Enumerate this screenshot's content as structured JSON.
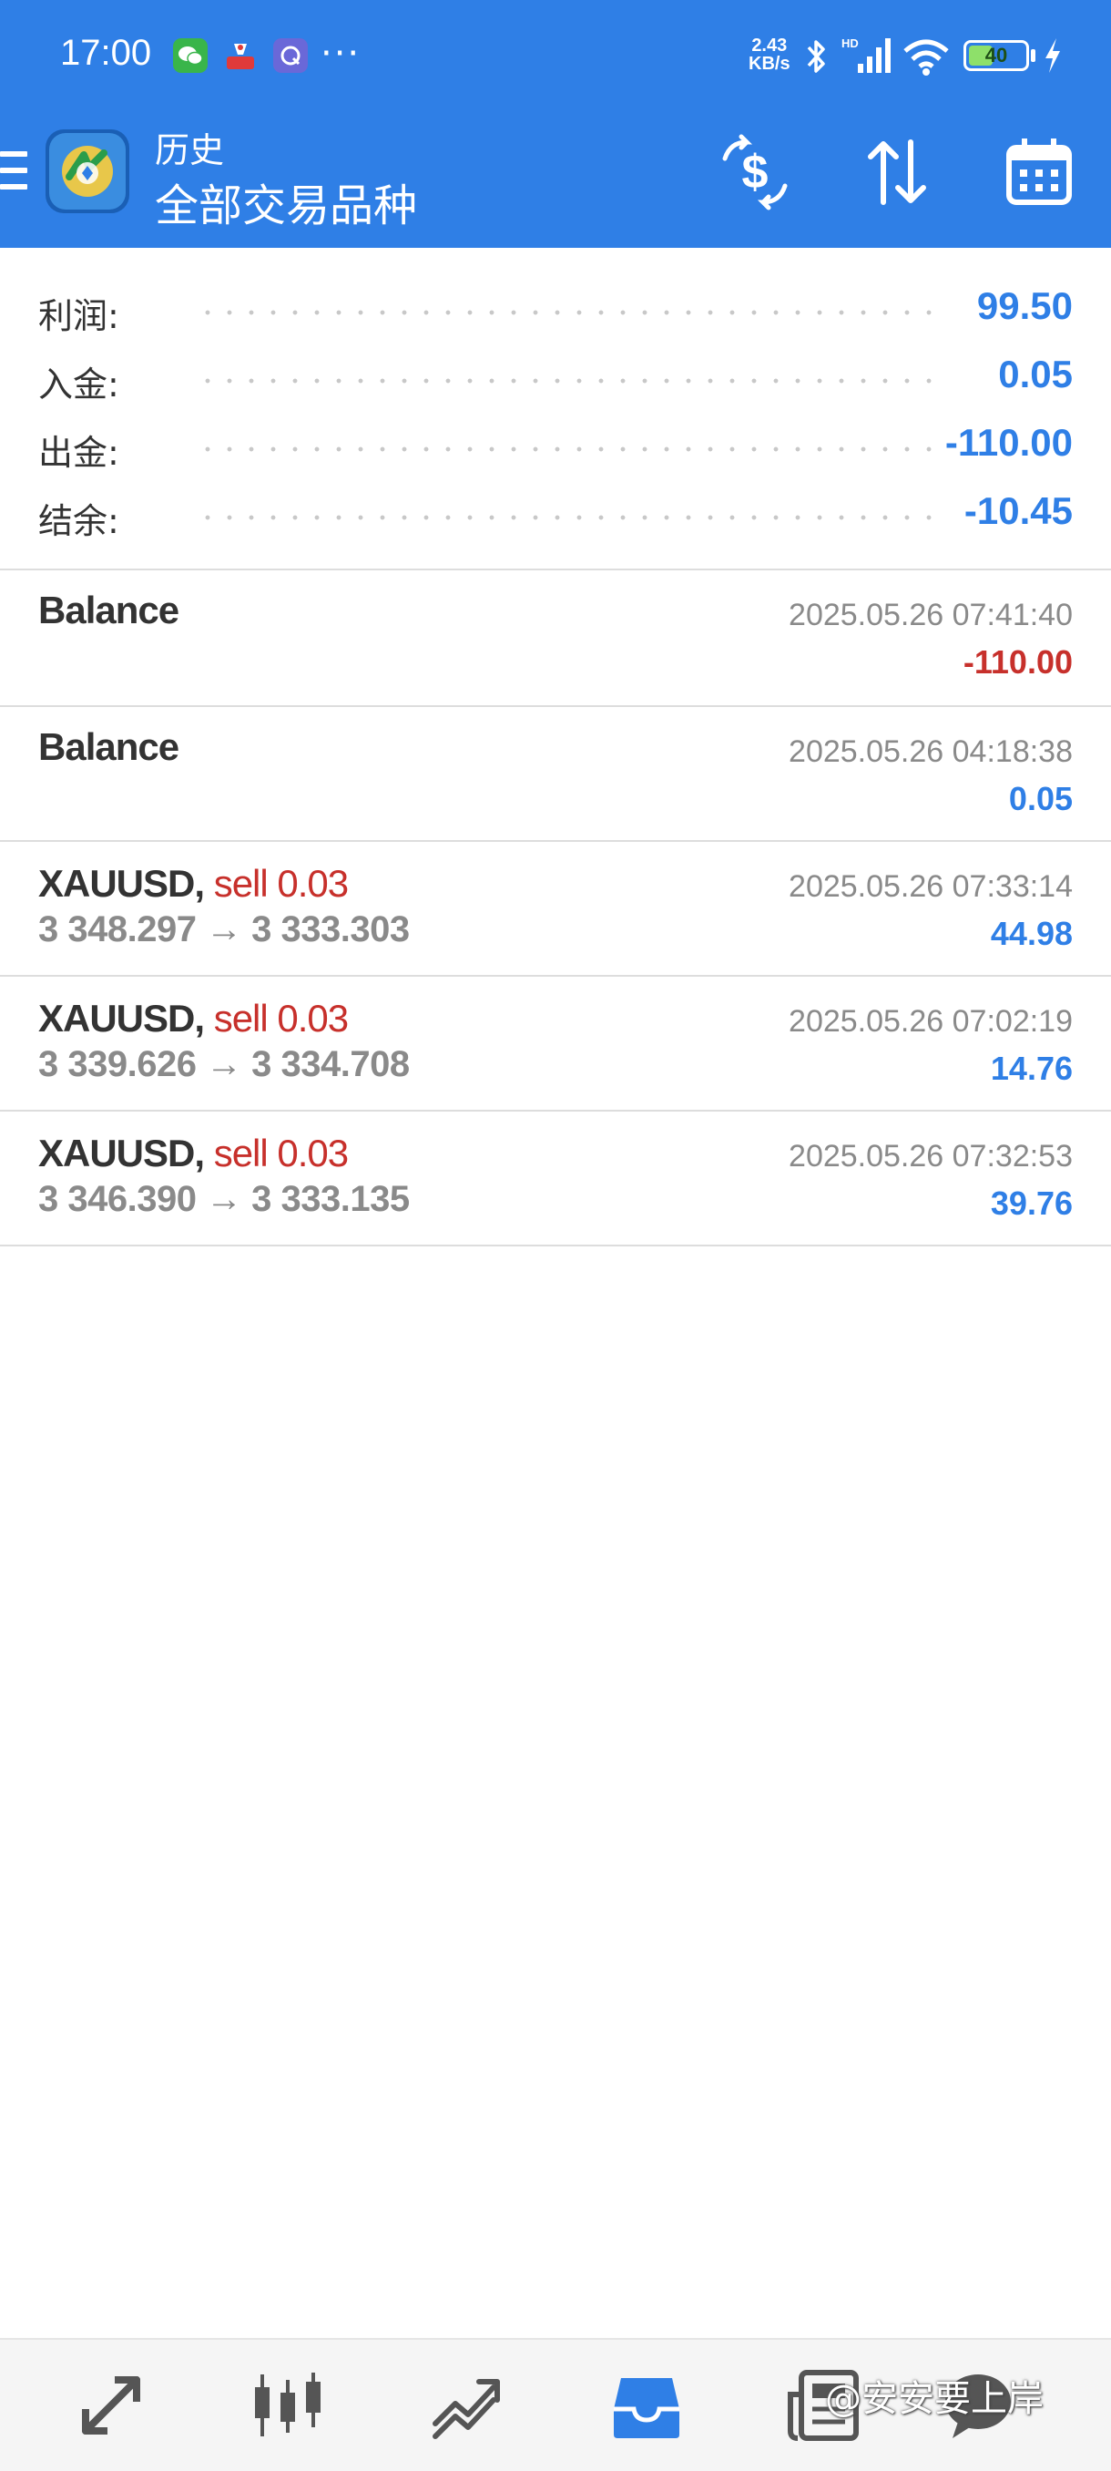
{
  "status_bar": {
    "time": "17:00",
    "apps": [
      "wechat-icon",
      "red-app-icon",
      "q-app-icon"
    ],
    "more": "···",
    "net_speed_value": "2.43",
    "net_speed_unit": "KB/s",
    "network": "HD",
    "battery": "40"
  },
  "header": {
    "subtitle": "历史",
    "title": "全部交易品种",
    "actions": [
      "currency-exchange-icon",
      "sort-icon",
      "calendar-icon"
    ]
  },
  "summary": [
    {
      "label": "利润:",
      "value": "99.50"
    },
    {
      "label": "入金:",
      "value": "0.05"
    },
    {
      "label": "出金:",
      "value": "-110.00"
    },
    {
      "label": "结余:",
      "value": "-10.45"
    }
  ],
  "balances": [
    {
      "title": "Balance",
      "time": "2025.05.26 07:41:40",
      "amount": "-110.00"
    },
    {
      "title": "Balance",
      "time": "2025.05.26 04:18:38",
      "amount": "0.05"
    }
  ],
  "trades": [
    {
      "symbol": "XAUUSD,",
      "side": "sell 0.03",
      "prices": "3 348.297 → 3 333.303",
      "time": "2025.05.26 07:33:14",
      "profit": "44.98"
    },
    {
      "symbol": "XAUUSD,",
      "side": "sell 0.03",
      "prices": "3 339.626 → 3 334.708",
      "time": "2025.05.26 07:02:19",
      "profit": "14.76"
    },
    {
      "symbol": "XAUUSD,",
      "side": "sell 0.03",
      "prices": "3 346.390 → 3 333.135",
      "time": "2025.05.26 07:32:53",
      "profit": "39.76"
    }
  ],
  "colors": {
    "primary": "#2f7fe6",
    "negative": "#c7302b",
    "muted": "#8a8a8a"
  },
  "bottom_nav": [
    "quotes-icon",
    "chart-icon",
    "trade-icon",
    "history-icon",
    "news-icon",
    "chat-icon"
  ],
  "watermark": "@安安要上岸"
}
